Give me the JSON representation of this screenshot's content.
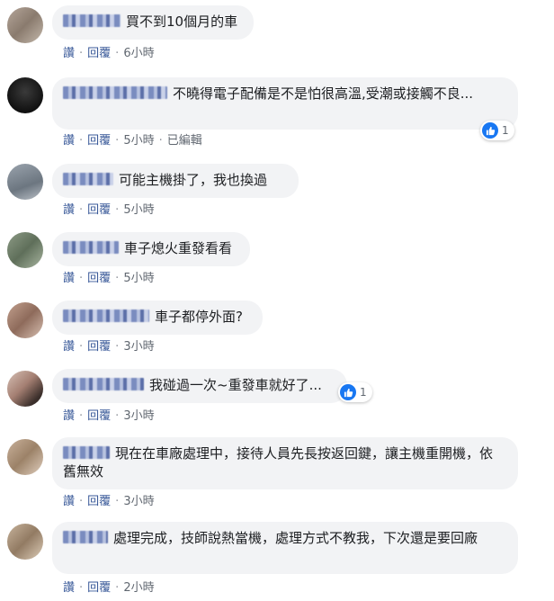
{
  "labels": {
    "like": "讚",
    "reply": "回覆",
    "edited": "已編輯"
  },
  "comments": [
    {
      "text": "買不到10個月的車",
      "time": "6小時"
    },
    {
      "text": "不曉得電子配備是不是怕很高溫,受潮或接觸不良...",
      "time": "5小時",
      "edited": true,
      "reactions": "1"
    },
    {
      "text": "可能主機掛了，我也換過",
      "time": "5小時"
    },
    {
      "text": "車子熄火重發看看",
      "time": "5小時"
    },
    {
      "text": "車子都停外面?",
      "time": "3小時"
    },
    {
      "text": "我碰過一次~重發車就好了...",
      "time": "3小時",
      "reactions": "1"
    },
    {
      "text": "現在在車廠處理中，接待人員先長按返回鍵，讓主機重開機，依舊無效",
      "time": "3小時"
    },
    {
      "text": "處理完成，技師說熱當機，處理方式不教我，下次還是要回廠",
      "time": "2小時"
    }
  ],
  "colors": {
    "bubble": "#f2f3f5",
    "link": "#385898",
    "meta": "#606770",
    "like": "#1877f2"
  }
}
